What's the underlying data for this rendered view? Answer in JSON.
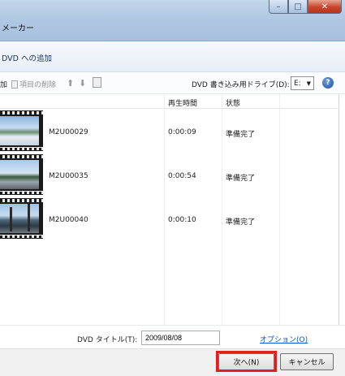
{
  "window": {
    "title": "メーカー",
    "controls": {
      "minimize": "–",
      "maximize": "□",
      "close": "✕"
    }
  },
  "header": {
    "heading": "DVD への追加"
  },
  "toolbar": {
    "add_label": "加",
    "remove_label": "項目の削除",
    "drive_label": "DVD 書き込み用ドライブ(D):",
    "drive_value": "E:",
    "help_glyph": "?"
  },
  "list": {
    "columns": {
      "duration": "再生時間",
      "status": "状態"
    },
    "rows": [
      {
        "name": "M2U00029",
        "duration": "0:00:09",
        "status": "準備完了"
      },
      {
        "name": "M2U00035",
        "duration": "0:00:54",
        "status": "準備完了"
      },
      {
        "name": "M2U00040",
        "duration": "0:00:10",
        "status": "準備完了"
      }
    ]
  },
  "bottom": {
    "dvd_title_label": "DVD タイトル(T):",
    "dvd_title_value": "2009/08/08",
    "options_link": "オプション(O)"
  },
  "footer": {
    "next_label": "次へ(N)",
    "cancel_label": "キャンセル"
  },
  "colors": {
    "accent_highlight": "#e02020",
    "link": "#0a55c8"
  },
  "icons": [
    "minimize-icon",
    "maximize-icon",
    "close-icon",
    "document-icon",
    "move-up-icon",
    "move-down-icon",
    "page-icon",
    "help-icon",
    "dropdown-caret-icon"
  ]
}
